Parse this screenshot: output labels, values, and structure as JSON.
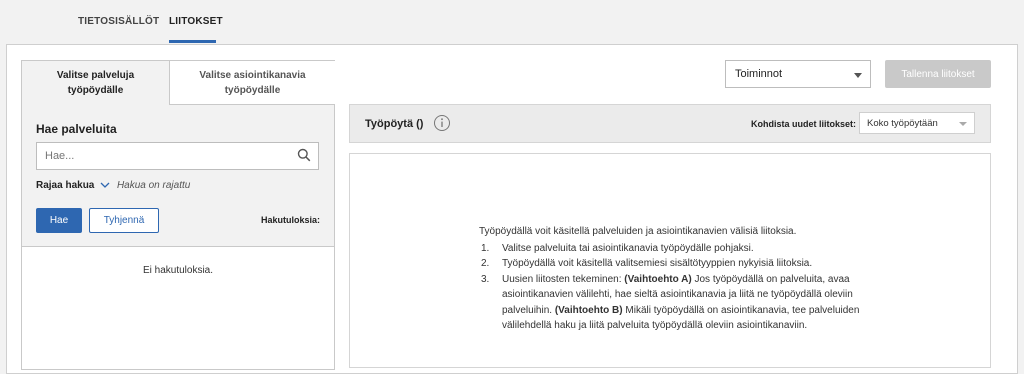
{
  "top_tabs": [
    {
      "label": "TIETOSISÄLLÖT",
      "active": false
    },
    {
      "label": "LIITOKSET",
      "active": true
    }
  ],
  "left_panel": {
    "tabs": [
      {
        "line1": "Valitse palveluja",
        "line2": "työpöydälle",
        "active": true
      },
      {
        "line1": "Valitse asiointikanavia",
        "line2": "työpöydälle",
        "active": false
      }
    ],
    "search_label": "Hae palveluita",
    "search_placeholder": "Hae...",
    "filter_label": "Rajaa hakua",
    "filter_note": "Hakua on rajattu",
    "search_button": "Hae",
    "clear_button": "Tyhjennä",
    "results_label": "Hakutuloksia:",
    "no_results": "Ei hakutuloksia."
  },
  "actions": {
    "select_value": "Toiminnot",
    "save_button": "Tallenna liitokset"
  },
  "desk": {
    "title": "Työpöytä ()",
    "target_label": "Kohdista uudet liitokset:",
    "target_value": "Koko työpöytään",
    "intro": "Työpöydällä voit käsitellä palveluiden ja asiointikanavien välisiä liitoksia.",
    "steps": [
      {
        "num": "1.",
        "text": "Valitse palveluita tai asiointikanavia työpöydälle pohjaksi."
      },
      {
        "num": "2.",
        "text": "Työpöydällä voit käsitellä valitsemiesi sisältötyyppien nykyisiä liitoksia."
      },
      {
        "num": "3.",
        "pre": "Uusien liitosten tekeminen:",
        "opt_a": "(Vaihtoehto A)",
        "a_text": "Jos työpöydällä on palveluita, avaa asiointikanavien välilehti, hae sieltä asiointikanavia ja liitä ne työpöydällä oleviin palveluihin.",
        "opt_b": "(Vaihtoehto B)",
        "b_text": "Mikäli työpöydällä on asiointikanavia, tee palveluiden välilehdellä haku ja liitä palveluita työpöydällä oleviin asiointikanaviin."
      }
    ]
  },
  "colors": {
    "accent": "#2e67b1",
    "disabled": "#c9c9c9",
    "panel_bg": "#f2f2f2"
  }
}
